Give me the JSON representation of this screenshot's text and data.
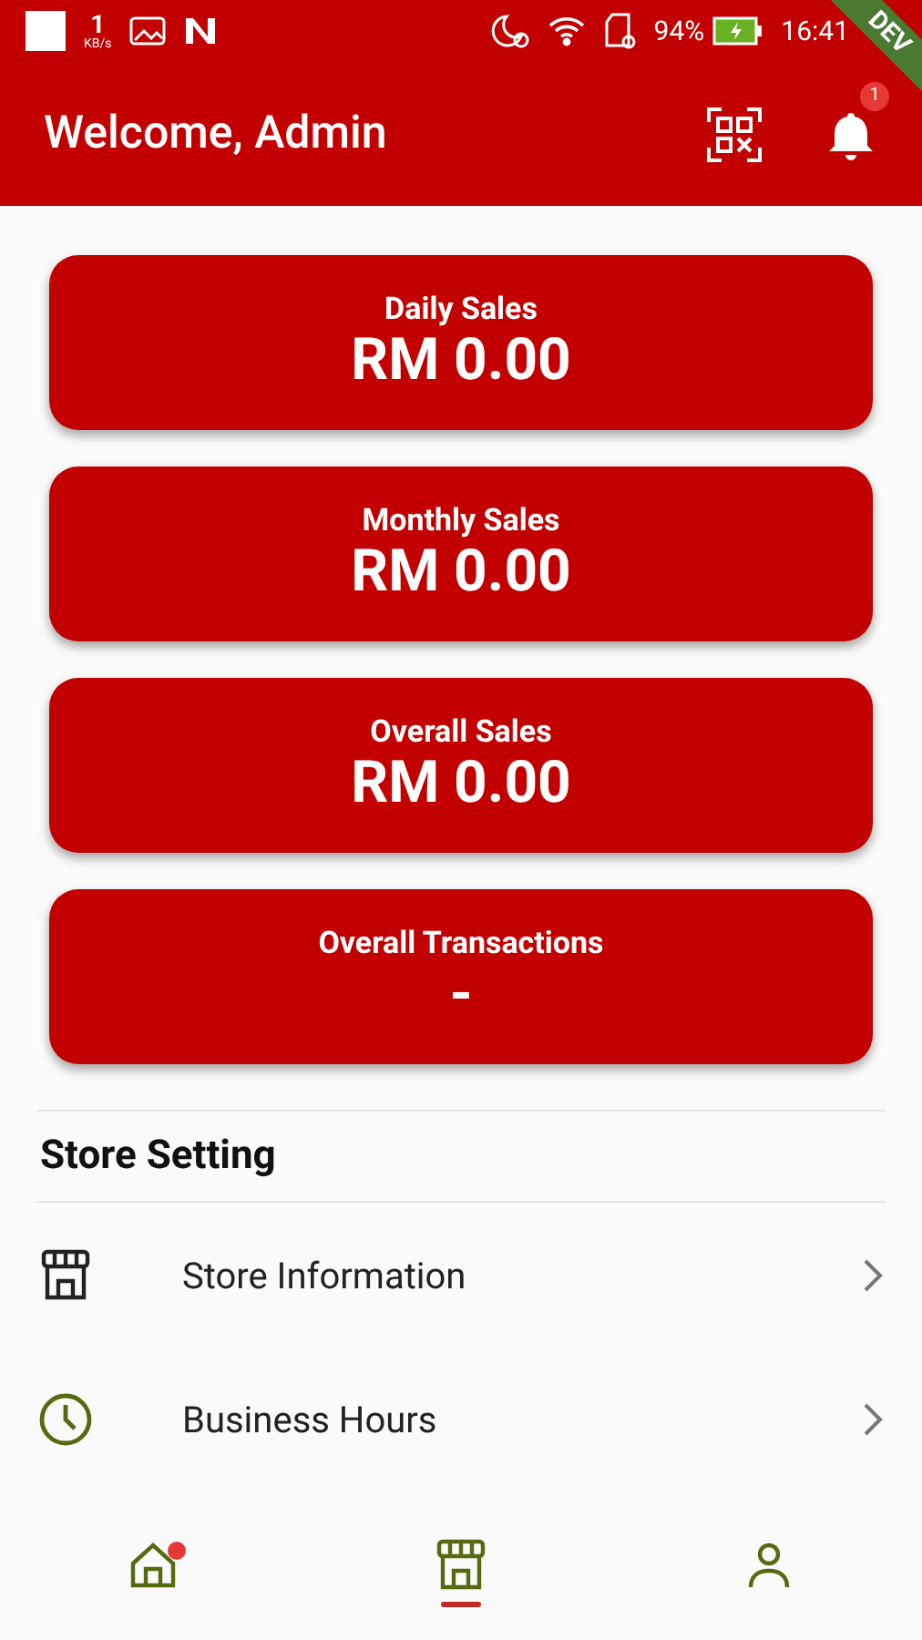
{
  "status_bar": {
    "speed": "1",
    "speed_unit": "KB/s",
    "battery": "94%",
    "time": "16:41"
  },
  "dev_banner": "DEV",
  "header": {
    "title": "Welcome, Admin",
    "notification_count": "1"
  },
  "stats": [
    {
      "label": "Daily Sales",
      "value": "RM 0.00"
    },
    {
      "label": "Monthly Sales",
      "value": "RM 0.00"
    },
    {
      "label": "Overall Sales",
      "value": "RM 0.00"
    },
    {
      "label": "Overall Transactions",
      "value": "-"
    }
  ],
  "section": {
    "title": "Store Setting"
  },
  "settings": [
    {
      "kind": "store",
      "label": "Store Information"
    },
    {
      "kind": "clock",
      "label": "Business Hours"
    }
  ],
  "nav": [
    {
      "kind": "home",
      "selected": false,
      "badge": true
    },
    {
      "kind": "store",
      "selected": true,
      "badge": false
    },
    {
      "kind": "person",
      "selected": false,
      "badge": false
    }
  ]
}
